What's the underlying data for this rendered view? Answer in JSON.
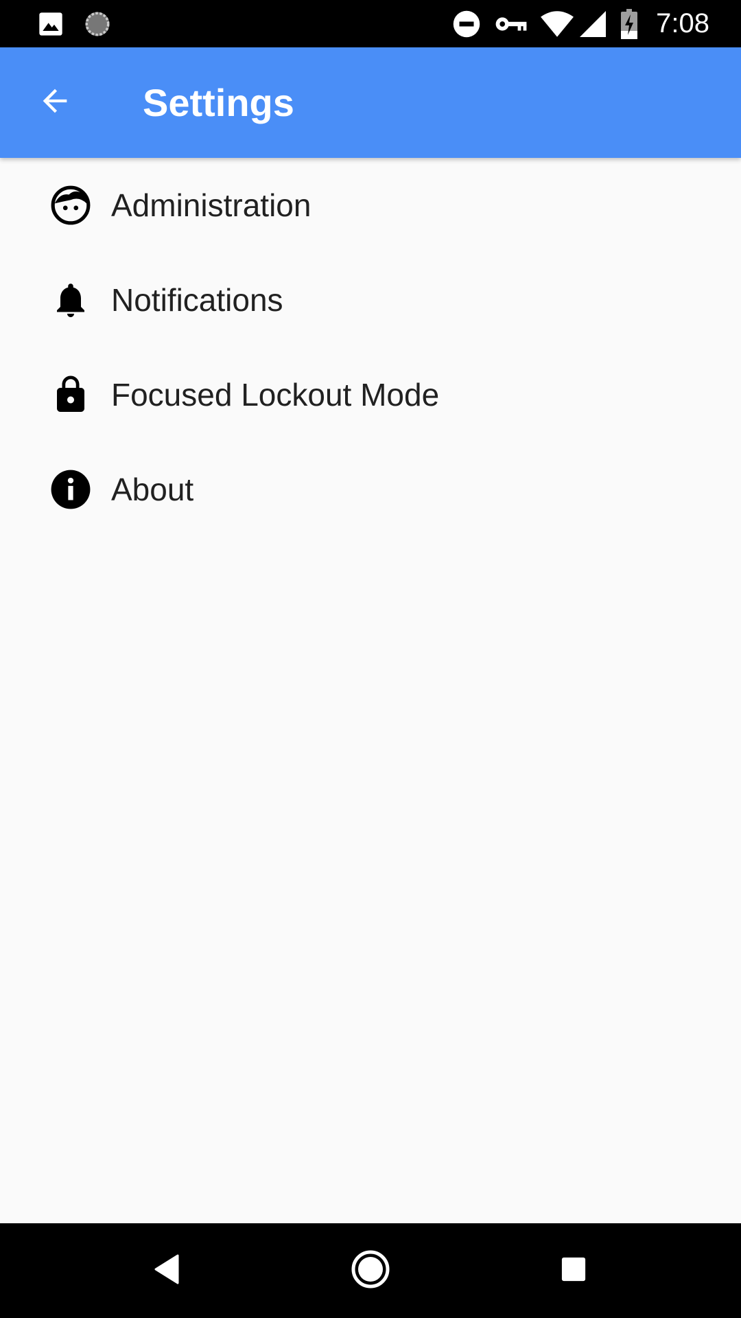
{
  "status_bar": {
    "time": "7:08",
    "left_icons": [
      "image-icon",
      "loading-spinner-icon"
    ],
    "right_icons": [
      "do-not-disturb-icon",
      "vpn-key-icon",
      "wifi-icon",
      "cellular-signal-icon",
      "battery-charging-icon"
    ]
  },
  "app_bar": {
    "title": "Settings",
    "back_icon": "arrow-back-icon",
    "color": "#4a8ef7"
  },
  "settings": {
    "items": [
      {
        "label": "Administration",
        "icon": "face-icon"
      },
      {
        "label": "Notifications",
        "icon": "bell-icon"
      },
      {
        "label": "Focused Lockout Mode",
        "icon": "lock-icon"
      },
      {
        "label": "About",
        "icon": "info-icon"
      }
    ]
  },
  "nav_bar": {
    "buttons": [
      "back-triangle-icon",
      "home-circle-icon",
      "recents-square-icon"
    ]
  }
}
